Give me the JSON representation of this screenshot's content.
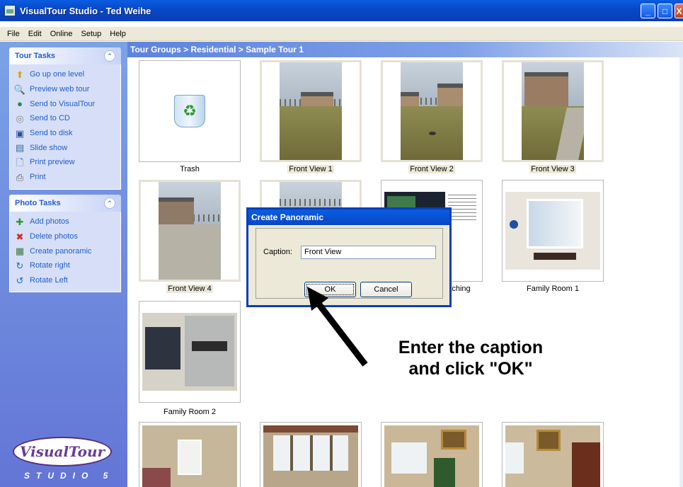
{
  "window": {
    "title": "VisualTour Studio - Ted Weihe",
    "buttons": [
      "_",
      "□",
      "X"
    ]
  },
  "menu": [
    "File",
    "Edit",
    "Online",
    "Setup",
    "Help"
  ],
  "breadcrumb": "Tour Groups > Residential > Sample Tour 1",
  "tour_tasks": {
    "title": "Tour Tasks",
    "items": [
      {
        "label": "Go up one level",
        "icon": "up-level-icon"
      },
      {
        "label": "Preview web tour",
        "icon": "preview-web-icon"
      },
      {
        "label": "Send to VisualTour",
        "icon": "globe-icon"
      },
      {
        "label": "Send to CD",
        "icon": "cd-icon"
      },
      {
        "label": "Send to disk",
        "icon": "floppy-icon"
      },
      {
        "label": "Slide show",
        "icon": "slideshow-icon"
      },
      {
        "label": "Print preview",
        "icon": "print-preview-icon"
      },
      {
        "label": "Print",
        "icon": "printer-icon"
      }
    ]
  },
  "photo_tasks": {
    "title": "Photo Tasks",
    "items": [
      {
        "label": "Add photos",
        "icon": "plus-icon"
      },
      {
        "label": "Delete photos",
        "icon": "delete-icon"
      },
      {
        "label": "Create panoramic",
        "icon": "panoramic-icon"
      },
      {
        "label": "Rotate right",
        "icon": "rotate-right-icon"
      },
      {
        "label": "Rotate Left",
        "icon": "rotate-left-icon"
      }
    ]
  },
  "logo": {
    "name": "VisualTour",
    "sub": "STUDIO 5"
  },
  "thumbnails": [
    {
      "caption": "Trash"
    },
    {
      "caption": "Front View 1"
    },
    {
      "caption": "Front View 2"
    },
    {
      "caption": "Front View 3"
    },
    {
      "caption": "Front View 4"
    },
    {
      "caption": "tching"
    },
    {
      "caption": "Family Room 1"
    },
    {
      "caption": "Family Room 2"
    }
  ],
  "dialog": {
    "title": "Create Panoramic",
    "caption_label": "Caption:",
    "caption_value": "Front View",
    "ok_label": "OK",
    "cancel_label": "Cancel"
  },
  "annotation": {
    "line1": "Enter the caption",
    "line2": "and click \"OK\""
  }
}
